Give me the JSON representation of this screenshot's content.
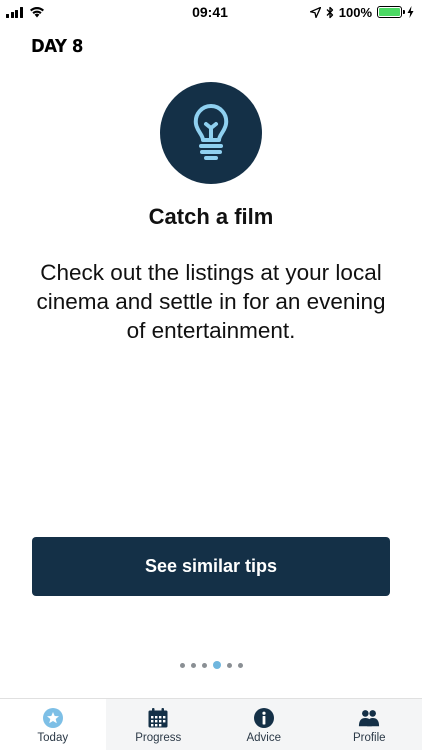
{
  "status_bar": {
    "time": "09:41",
    "battery_percent_label": "100%",
    "battery_level": 1.0
  },
  "day_label": "DAY 8",
  "tip": {
    "icon": "lightbulb-icon",
    "title": "Catch a film",
    "body": "Check out the listings at your local cinema and settle in for an evening of entertainment."
  },
  "cta": {
    "label": "See similar tips"
  },
  "pager": {
    "count": 6,
    "active_index": 3
  },
  "tab_bar": {
    "items": [
      {
        "label": "Today",
        "icon": "star-circle-icon",
        "active": true
      },
      {
        "label": "Progress",
        "icon": "calendar-icon",
        "active": false
      },
      {
        "label": "Advice",
        "icon": "info-icon",
        "active": false
      },
      {
        "label": "Profile",
        "icon": "people-icon",
        "active": false
      }
    ]
  },
  "colors": {
    "primary": "#143047",
    "accent": "#6fb6de",
    "battery": "#4cd964"
  }
}
